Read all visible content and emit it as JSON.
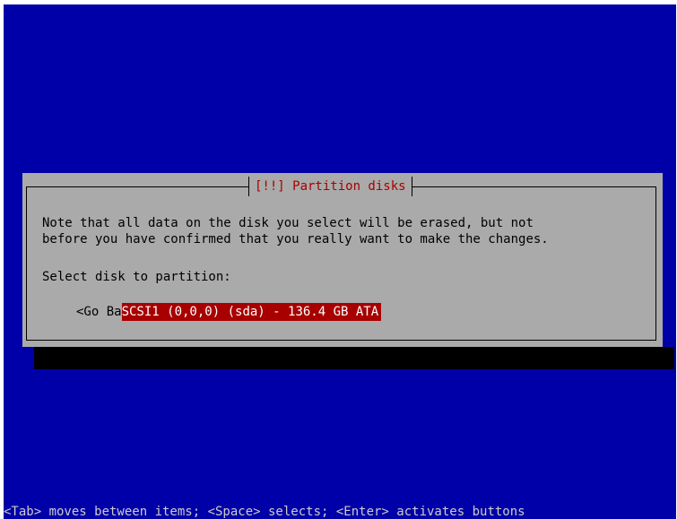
{
  "dialog": {
    "title": "[!!] Partition disks",
    "message_line_1": "Note that all data on the disk you select will be erased, but not",
    "message_line_2": "before you have confirmed that you really want to make the changes.",
    "select_prompt": "Select disk to partition:",
    "go_back_label": "<Go Ba",
    "disk_option_label": "SCSI1 (0,0,0) (sda) - 136.4 GB ATA"
  },
  "help_line": "<Tab> moves between items; <Space> selects; <Enter> activates buttons",
  "colors": {
    "screen_background": "#0000a8",
    "dialog_background": "#aaaaaa",
    "title_text": "#a80000",
    "selection_background": "#a80000",
    "selection_text": "#ffffff",
    "help_text": "#cccccc",
    "shadow": "#000000"
  }
}
